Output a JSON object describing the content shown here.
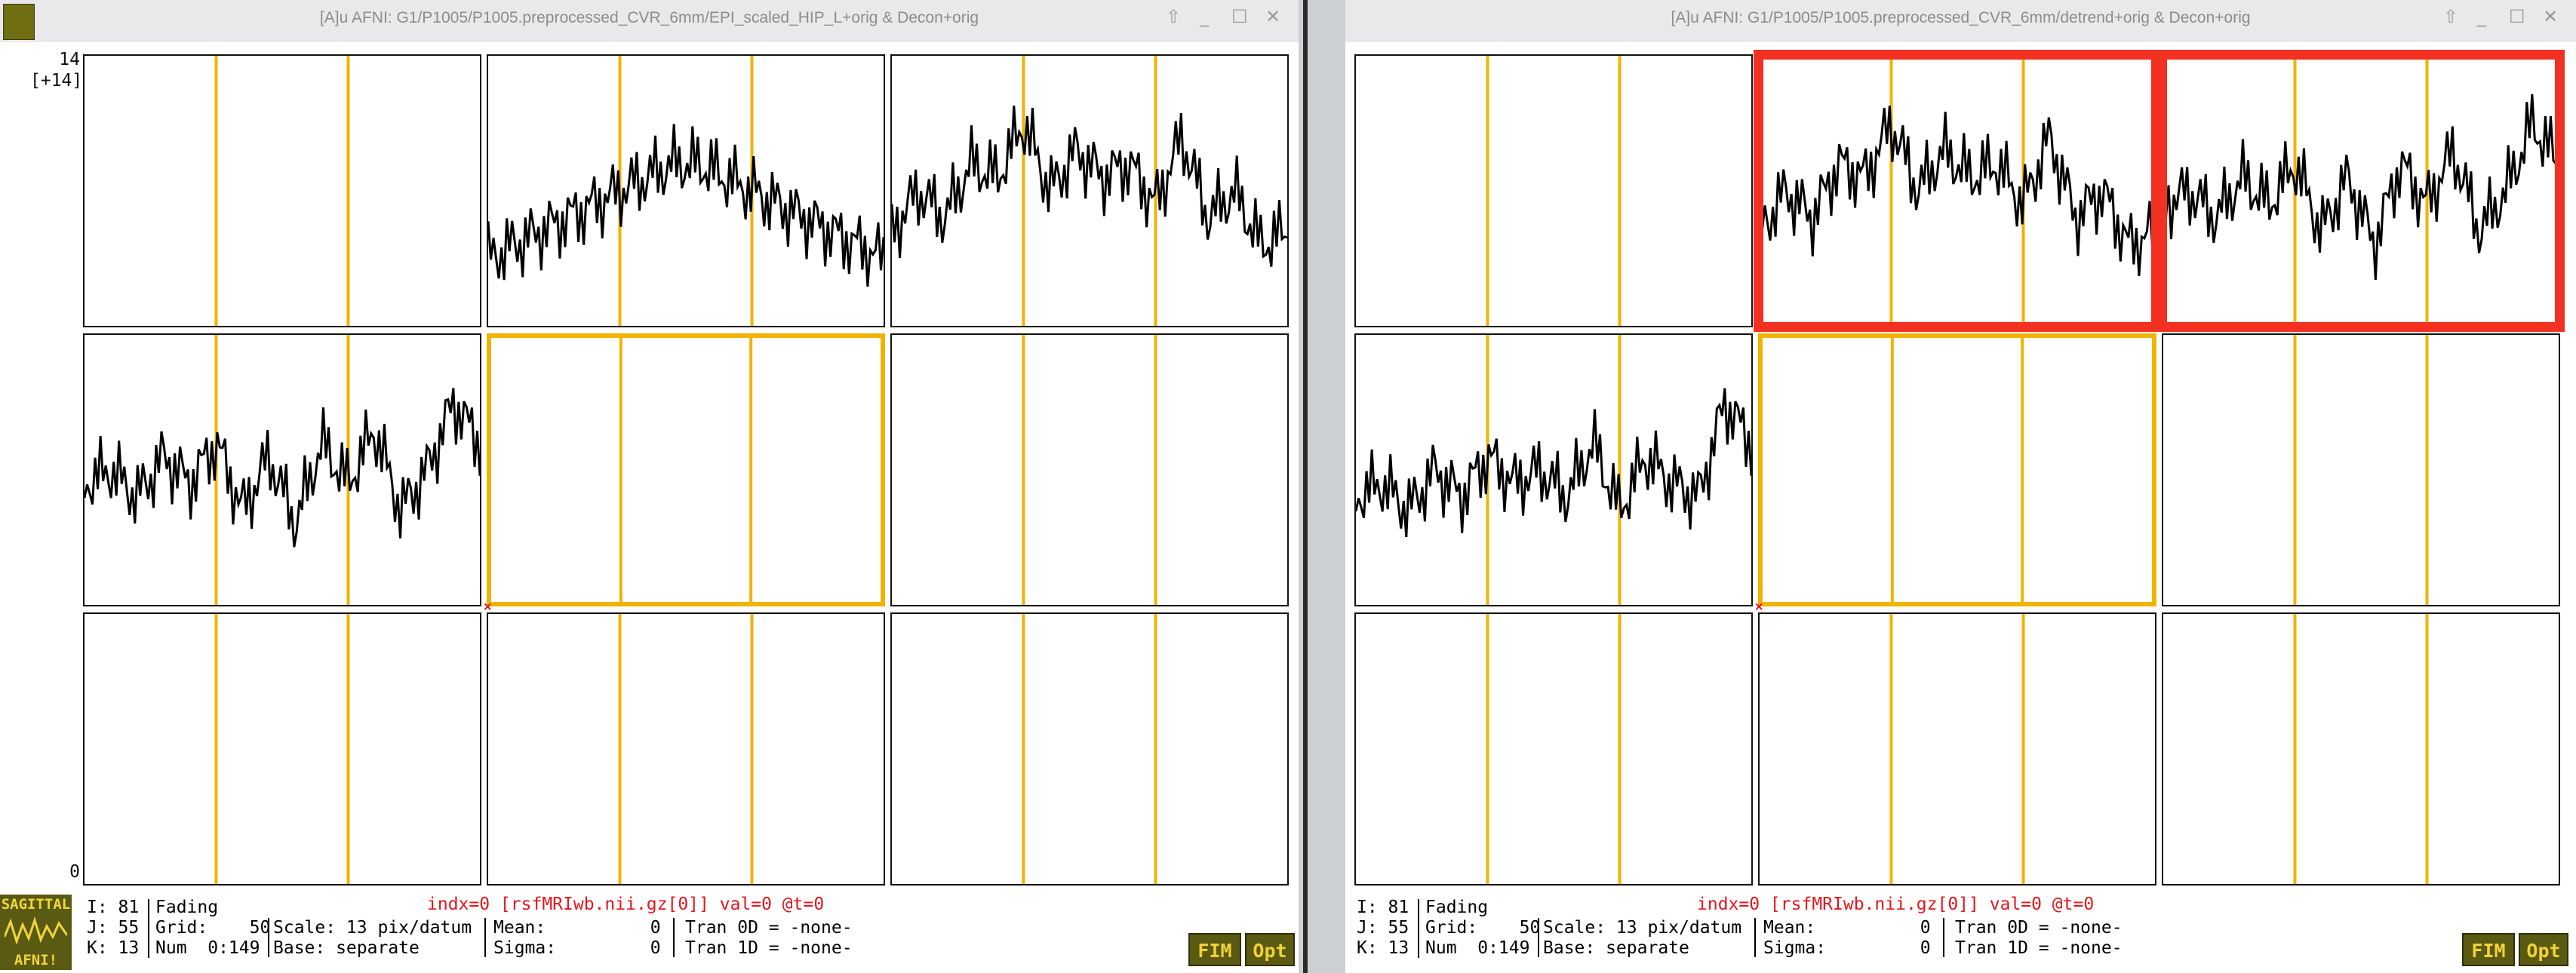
{
  "windows": [
    {
      "title": "[A]u AFNI: G1/P1005/P1005.preprocessed_CVR_6mm/EPI_scaled_HIP_L+orig & Decon+orig",
      "y_top_label": "14",
      "y_top_sub": "[+14]",
      "y_bottom_label": "0",
      "selected_cell": 4,
      "highlighted_cells": [],
      "footer": {
        "coords": [
          "I: 81",
          "J: 55",
          "K: 13"
        ],
        "mode": [
          "Fading",
          "Grid:    50",
          "Num  0:149"
        ],
        "scale": [
          "Scale: 13 pix/datum",
          "Base: separate"
        ],
        "stats": [
          "Mean:          0",
          "Sigma:         0"
        ],
        "tran": [
          "Tran 0D = -none-",
          "Tran 1D = -none-"
        ],
        "index_line": "indx=0 [rsfMRIwb.nii.gz[0]] val=0 @t=0",
        "fim_label": "FIM",
        "opt_label": "Opt"
      }
    },
    {
      "title": "[A]u AFNI: G1/P1005/P1005.preprocessed_CVR_6mm/detrend+orig & Decon+orig",
      "y_top_label": "",
      "y_top_sub": "",
      "y_bottom_label": "",
      "selected_cell": 4,
      "highlighted_cells": [
        1,
        2
      ],
      "footer": {
        "coords": [
          "I: 81",
          "J: 55",
          "K: 13"
        ],
        "mode": [
          "Fading",
          "Grid:    50",
          "Num  0:149"
        ],
        "scale": [
          "Scale: 13 pix/datum",
          "Base: separate"
        ],
        "stats": [
          "Mean:          0",
          "Sigma:         0"
        ],
        "tran": [
          "Tran 0D = -none-",
          "Tran 1D = -none-"
        ],
        "index_line": "indx=0 [rsfMRIwb.nii.gz[0]] val=0 @t=0",
        "fim_label": "FIM",
        "opt_label": "Opt"
      }
    }
  ],
  "sagittal_icon": {
    "top": "SAGITTAL",
    "bottom": "AFNI!"
  },
  "colors": {
    "grid_line": "#f0b400",
    "selected_border": "#f0b400",
    "highlight_frame": "#f23122",
    "trace": "#000000",
    "index_text": "#e8141c"
  },
  "chart_data": {
    "type": "line",
    "x_range": [
      0,
      149
    ],
    "series": [
      {
        "values": [
          0.25,
          0.3,
          0.35,
          0.4,
          0.45,
          0.5,
          0.55,
          0.6,
          0.6,
          0.55,
          0.5,
          0.45,
          0.4,
          0.35,
          0.3,
          0.25
        ]
      },
      {
        "values": [
          0.35,
          0.5,
          0.4,
          0.6,
          0.55,
          0.75,
          0.5,
          0.65,
          0.55,
          0.6,
          0.45,
          0.7,
          0.4,
          0.5,
          0.3,
          0.35
        ]
      },
      {
        "values": [
          0.45,
          0.5,
          0.4,
          0.55,
          0.45,
          0.6,
          0.35,
          0.55,
          0.3,
          0.6,
          0.45,
          0.65,
          0.35,
          0.5,
          0.75,
          0.6
        ]
      },
      {
        "values": [
          0.4,
          0.45,
          0.35,
          0.5,
          0.4,
          0.55,
          0.45,
          0.5,
          0.4,
          0.6,
          0.35,
          0.55,
          0.45,
          0.4,
          0.75,
          0.6
        ]
      },
      {
        "values": [
          0.4,
          0.45,
          0.3,
          0.5,
          0.35,
          0.5,
          0.55,
          0.45,
          0.35,
          0.6,
          0.4,
          0.5,
          0.7,
          0.45,
          0.6,
          0.55
        ]
      }
    ]
  }
}
